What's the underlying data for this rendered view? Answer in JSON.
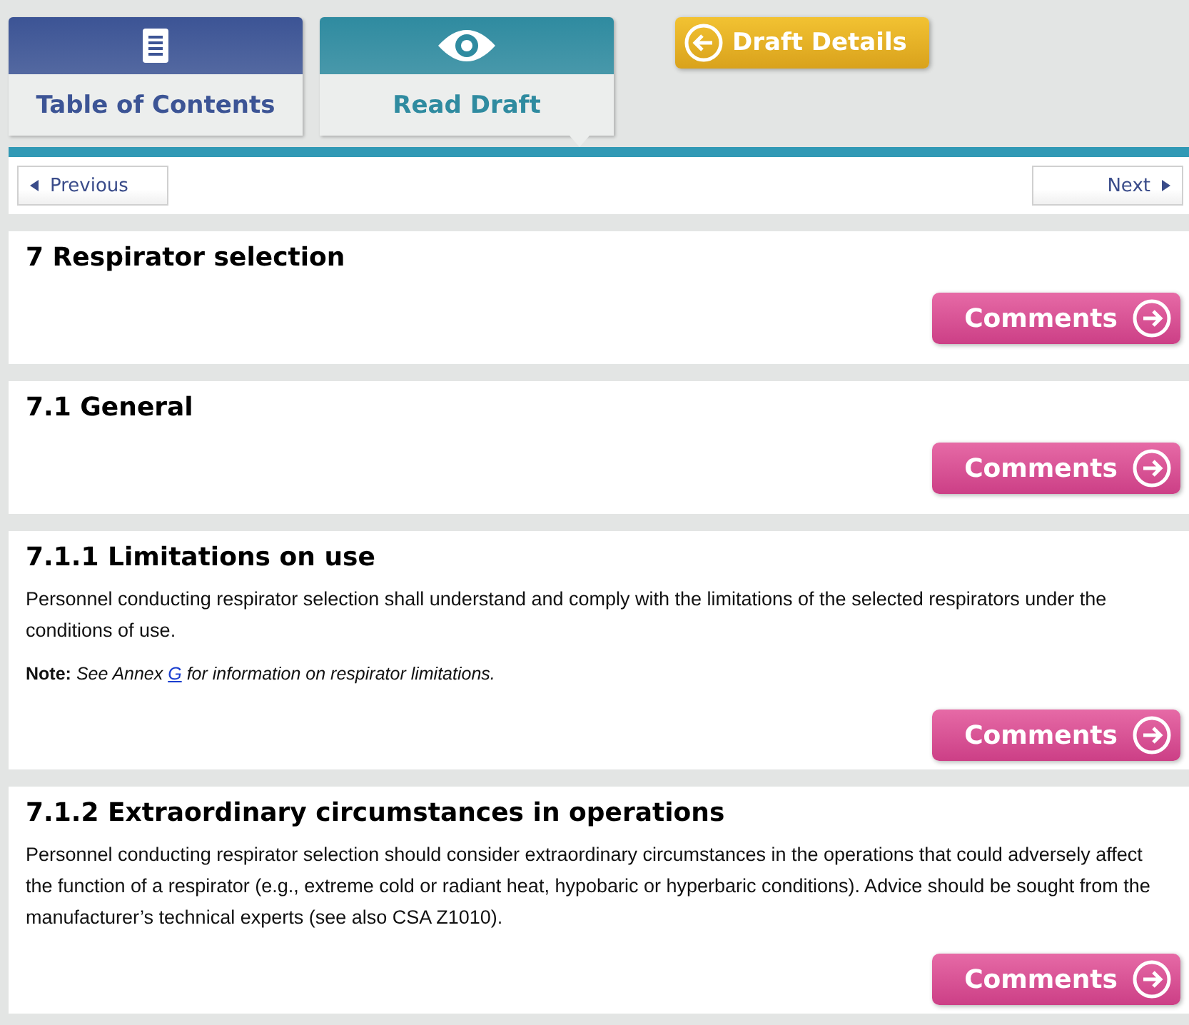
{
  "tabs": [
    {
      "label": "Table of Contents",
      "selected": false,
      "color": "#3c5495"
    },
    {
      "label": "Read Draft",
      "selected": true,
      "color": "#2f8ba0"
    }
  ],
  "draft_details_button": "Draft Details",
  "nav": {
    "previous": "Previous",
    "next": "Next"
  },
  "sections": [
    {
      "heading": "7 Respirator selection",
      "comments_button": "Comments"
    },
    {
      "heading": "7.1 General",
      "comments_button": "Comments"
    },
    {
      "heading": "7.1.1 Limitations on use",
      "paragraphs": [
        "Personnel conducting respirator selection shall understand and comply with the limitations of the selected respirators under the conditions of use."
      ],
      "note": {
        "label": "Note:",
        "text_before": "See Annex ",
        "link": "G",
        "text_after": " for information on respirator limitations."
      },
      "comments_button": "Comments"
    },
    {
      "heading": "7.1.2 Extraordinary circumstances in operations",
      "paragraphs": [
        "Personnel conducting respirator selection should consider extraordinary circumstances in the operations that could adversely affect the function of a respirator (e.g., extreme cold or radiant heat, hypobaric or hyperbaric conditions). Advice should be sought from the manufacturer’s technical experts (see also CSA Z1010)."
      ],
      "comments_button": "Comments"
    }
  ]
}
